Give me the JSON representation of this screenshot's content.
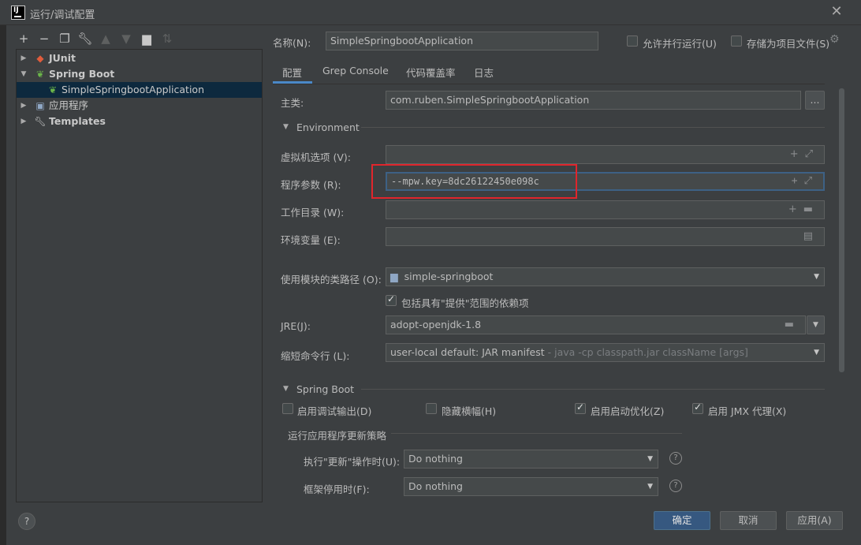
{
  "window": {
    "title": "运行/调试配置",
    "app_icon_text": "IJ",
    "close_icon": "close-icon"
  },
  "toolbar": {
    "icons": [
      "plus-icon",
      "minus-icon",
      "copy-icon",
      "wrench-icon",
      "arrow-up-icon",
      "arrow-down-icon",
      "folder-add-icon",
      "sort-icon"
    ]
  },
  "tree": {
    "items": [
      {
        "label": "JUnit",
        "expanded": false,
        "bold": true,
        "icon": "junit-icon"
      },
      {
        "label": "Spring Boot",
        "expanded": true,
        "bold": true,
        "icon": "spring-boot-icon"
      },
      {
        "label": "SimpleSpringbootApplication",
        "selected": true,
        "icon": "spring-boot-app-icon"
      },
      {
        "label": "应用程序",
        "expanded": false,
        "icon": "application-icon"
      },
      {
        "label": "Templates",
        "expanded": false,
        "bold": true,
        "icon": "wrench-icon"
      }
    ]
  },
  "header": {
    "name_label": "名称(N):",
    "name_value": "SimpleSpringbootApplication",
    "allow_parallel_label": "允许并行运行(U)",
    "store_as_file_label": "存储为项目文件(S)"
  },
  "tabs": [
    {
      "label": "配置",
      "active": true
    },
    {
      "label": "Grep Console"
    },
    {
      "label": "代码覆盖率"
    },
    {
      "label": "日志"
    }
  ],
  "config": {
    "main_class_label": "主类:",
    "main_class_value": "com.ruben.SimpleSpringbootApplication",
    "browse_label": "...",
    "environment_title": "Environment",
    "vm_options_label": "虚拟机选项 (V):",
    "vm_options_value": "",
    "program_args_label": "程序参数 (R):",
    "program_args_value": "--mpw.key=8dc26122450e098c",
    "working_dir_label": "工作目录 (W):",
    "working_dir_value": "",
    "env_vars_label": "环境变量 (E):",
    "env_vars_value": "",
    "module_label": "使用模块的类路径 (O):",
    "module_value": "simple-springboot",
    "include_provided_label": "包括具有\"提供\"范围的依赖项",
    "include_provided_checked": true,
    "jre_label": "JRE(J):",
    "jre_value": "adopt-openjdk-1.8",
    "shorten_label": "缩短命令行 (L):",
    "shorten_value": "user-local default: JAR manifest",
    "shorten_hint": " - java -cp classpath.jar className [args]"
  },
  "spring_boot": {
    "title": "Spring Boot",
    "debug_output_label": "启用调试输出(D)",
    "debug_output_checked": false,
    "hide_banner_label": "隐藏横幅(H)",
    "hide_banner_checked": false,
    "launch_opt_label": "启用启动优化(Z)",
    "launch_opt_checked": true,
    "jmx_label": "启用 JMX 代理(X)",
    "jmx_checked": true,
    "update_policy_title": "运行应用程序更新策略",
    "on_update_label": "执行\"更新\"操作时(U):",
    "on_update_value": "Do nothing",
    "on_frame_deactivate_label": "框架停用时(F):",
    "on_frame_deactivate_value": "Do nothing"
  },
  "footer": {
    "help_label": "?",
    "ok_label": "确定",
    "cancel_label": "取消",
    "apply_label": "应用(A)"
  },
  "colors": {
    "background": "#3c3f41",
    "field_bg": "#45494a",
    "accent": "#365880",
    "selection": "#0d293e",
    "highlight_box": "#e0252c"
  }
}
